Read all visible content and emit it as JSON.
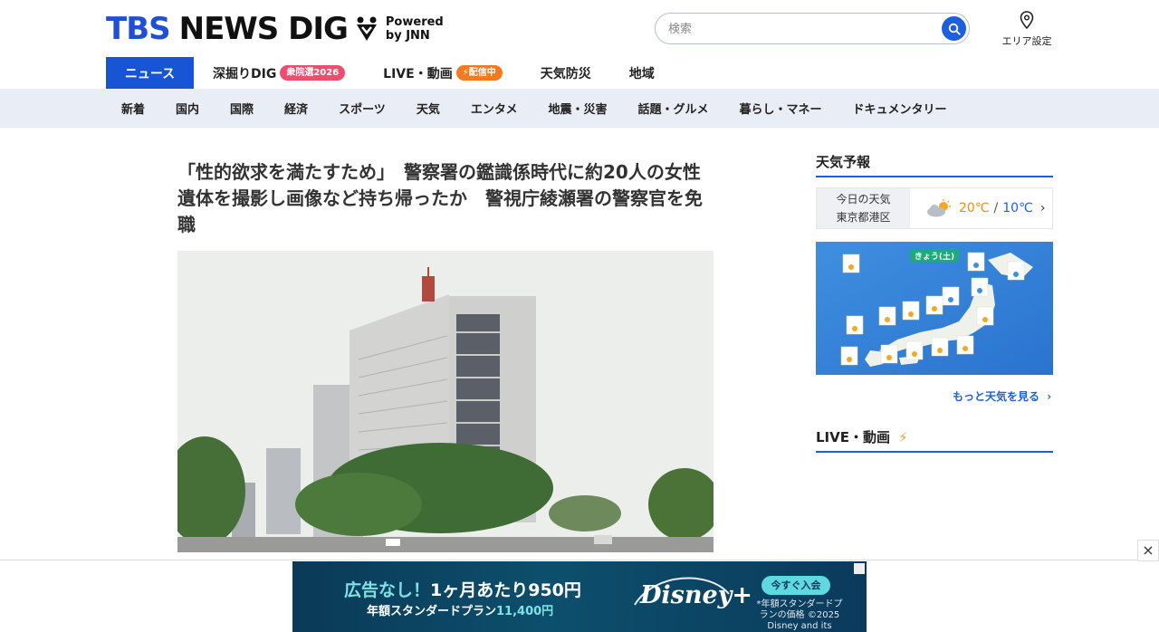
{
  "header": {
    "logo_tbs": "TBS",
    "logo_news": "NEWS DIG",
    "powered_line1": "Powered",
    "powered_line2": "by JNN",
    "search_placeholder": "検索",
    "area_label": "エリア設定"
  },
  "main_nav": [
    {
      "label": "ニュース",
      "active": true
    },
    {
      "label": "深掘りDIG",
      "badge": "衆院選2026",
      "badge_color": "#ee4d6e"
    },
    {
      "label": "LIVE・動画",
      "badge": "配信中",
      "badge_color": "#f47a1f"
    },
    {
      "label": "天気防災"
    },
    {
      "label": "地域"
    }
  ],
  "sub_nav": [
    "新着",
    "国内",
    "国際",
    "経済",
    "スポーツ",
    "天気",
    "エンタメ",
    "地震・災害",
    "話題・グルメ",
    "暮らし・マネー",
    "ドキュメンタリー"
  ],
  "article": {
    "headline": "「性的欲求を満たすため」　警察署の鑑識係時代に約20人の女性遺体を撮影し画像など持ち帰ったか　警視庁綾瀬署の警察官を免職"
  },
  "sidebar": {
    "weather_title": "天気予報",
    "today_line1": "今日の天気",
    "today_line2": "東京都港区",
    "temp_high": "20℃",
    "temp_sep": "/",
    "temp_low": "10℃",
    "map_banner": "きょう(土)",
    "more_weather": "もっと天気を見る",
    "live_title": "LIVE・動画"
  },
  "ad": {
    "line1_a": "広告なし！",
    "line1_b": "1ヶ月あたり950円",
    "line2_a": "年額スタンダードプラン",
    "line2_b": "11,400円",
    "brand": "Disney+",
    "cta": "今すぐ入会",
    "small": "*年額スタンダードプランの価格 ©2025 Disney and its",
    "close": "×"
  },
  "colors": {
    "brand_blue": "#1e4fd6",
    "nav_active": "#1754d6",
    "subnav_bg": "#e9edf5",
    "accent_orange": "#f47a1f"
  }
}
